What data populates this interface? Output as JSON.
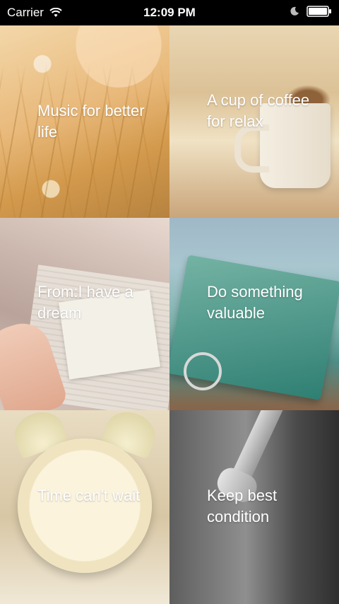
{
  "status_bar": {
    "carrier": "Carrier",
    "time": "12:09 PM",
    "icons": [
      "wifi-icon",
      "moon-icon",
      "battery-icon"
    ]
  },
  "tiles": [
    {
      "title": "Music for better life"
    },
    {
      "title": "A cup of coffee for relax"
    },
    {
      "title": "From:I have a dream"
    },
    {
      "title": "Do something valuable"
    },
    {
      "title": "Time can't wait"
    },
    {
      "title": "Keep best condition"
    }
  ],
  "colors": {
    "status_bar_bg": "#000000",
    "status_text": "#FFFFFF",
    "tile_text": "#FFFFFF"
  }
}
